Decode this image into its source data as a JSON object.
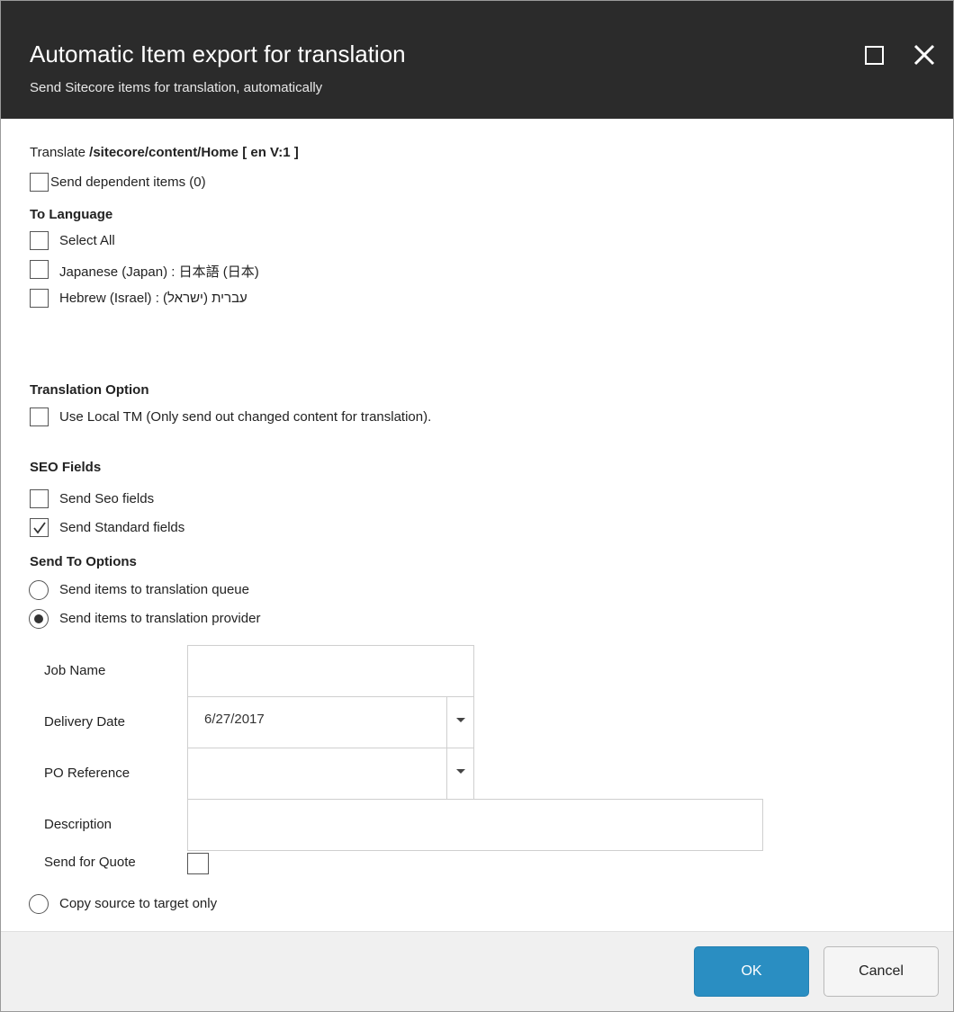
{
  "dialog": {
    "title": "Automatic Item export for translation",
    "subtitle": "Send Sitecore items for translation, automatically"
  },
  "translate": {
    "prefix": "Translate",
    "path": "/sitecore/content/Home [ en V:1 ]"
  },
  "dependent": {
    "label": "Send dependent items (0)",
    "checked": false
  },
  "to_language": {
    "heading": "To Language",
    "items": [
      {
        "label": "Select All",
        "checked": false
      },
      {
        "label": "Japanese (Japan) : 日本語 (日本)",
        "checked": false
      },
      {
        "label": "Hebrew (Israel) : עברית (ישראל)",
        "checked": false
      }
    ]
  },
  "translation_option": {
    "heading": "Translation Option",
    "local_tm_label": "Use Local TM (Only send out changed content for translation).",
    "local_tm_checked": false
  },
  "seo": {
    "heading": "SEO Fields",
    "items": [
      {
        "label": "Send Seo fields",
        "checked": false
      },
      {
        "label": "Send Standard fields",
        "checked": true
      }
    ]
  },
  "send_to": {
    "heading": "Send To Options",
    "queue_label": "Send items to translation queue",
    "provider_label": "Send items to translation provider",
    "copy_label": "Copy source to target only",
    "selected": "provider"
  },
  "provider_form": {
    "job_name_label": "Job Name",
    "job_name_value": "",
    "delivery_date_label": "Delivery Date",
    "delivery_date_value": "6/27/2017",
    "po_reference_label": "PO Reference",
    "po_reference_value": "",
    "description_label": "Description",
    "description_value": "",
    "send_for_quote_label": "Send for Quote",
    "send_for_quote_checked": false
  },
  "footer": {
    "ok_label": "OK",
    "cancel_label": "Cancel"
  },
  "icons": {
    "maximize": "maximize-icon",
    "close": "close-icon",
    "check": "checkmark-icon",
    "dropdown": "chevron-down-icon"
  },
  "colors": {
    "header_bg": "#2b2b2b",
    "ok_button": "#2a8ec2",
    "footer_bg": "#f0f0f0"
  }
}
